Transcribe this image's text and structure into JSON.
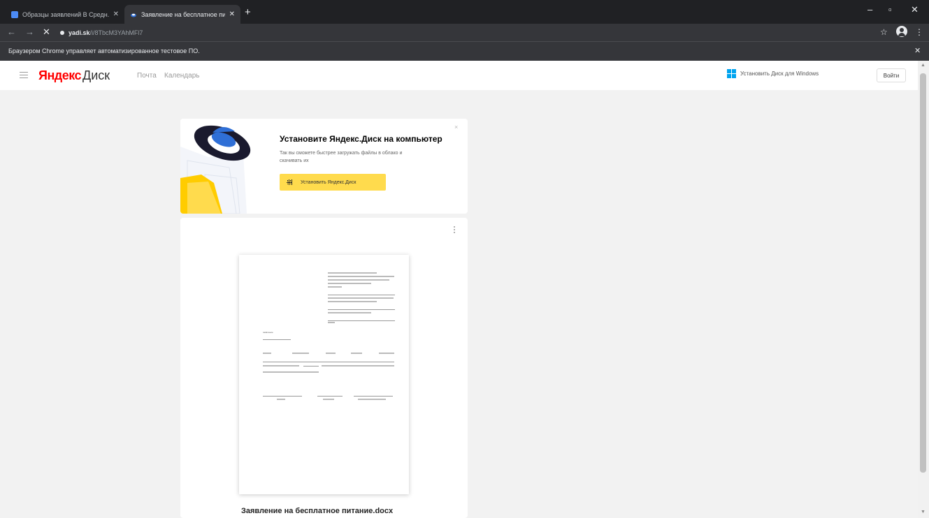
{
  "browser": {
    "tabs": [
      {
        "title": "Образцы заявлений В Средн...",
        "active": false
      },
      {
        "title": "Заявление на бесплатное пит...",
        "active": true
      }
    ],
    "new_tab": "+",
    "window_controls": {
      "minimize": "–",
      "maximize": "▫",
      "close": "✕"
    },
    "nav": {
      "back": "←",
      "forward": "→",
      "stop": "✕"
    },
    "address": {
      "host": "yadi.sk",
      "path": "/i/8TbcM3YAhMFl7"
    },
    "star": "☆",
    "menu": "⋮",
    "infobar_message": "Браузером Chrome управляет автоматизированное тестовое ПО.",
    "infobar_close": "✕"
  },
  "header": {
    "logo_brand": "Яндекс",
    "logo_product": "Диск",
    "nav": [
      "Почта",
      "Календарь"
    ],
    "install_windows_link": "Установить Диск для Windows",
    "login_button": "Войти"
  },
  "promo": {
    "title": "Установите Яндекс.Диск на компьютер",
    "text": "Так вы сможете быстрее загружать файлы в облако и скачивать их",
    "button": "Установить Яндекс.Диск",
    "close": "×"
  },
  "document": {
    "file_name": "Заявление на бесплатное питание.docx",
    "page_heading": "заявление"
  },
  "colors": {
    "brand_red": "#ff0000",
    "promo_button": "#ffdb4d",
    "windows_blue": "#00a4ef",
    "chrome_dark": "#202124"
  }
}
